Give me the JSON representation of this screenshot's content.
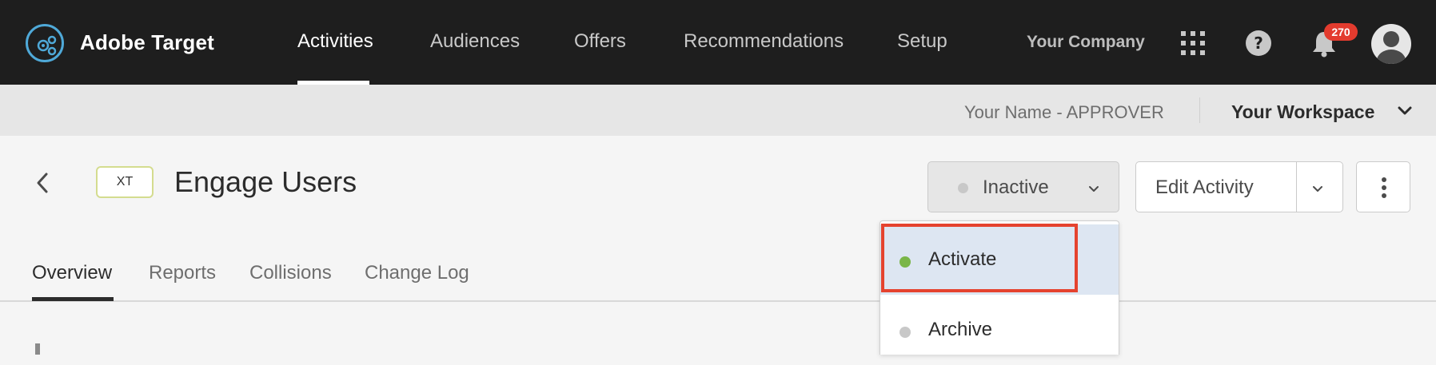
{
  "app": {
    "name": "Adobe Target"
  },
  "nav": {
    "items": [
      {
        "label": "Activities"
      },
      {
        "label": "Audiences"
      },
      {
        "label": "Offers"
      },
      {
        "label": "Recommendations"
      },
      {
        "label": "Setup"
      }
    ],
    "active": "Activities"
  },
  "header": {
    "company": "Your Company",
    "notifications_count": "270",
    "icons": [
      "app-grid-icon",
      "help-icon",
      "bell-icon",
      "user-avatar-icon"
    ]
  },
  "subbar": {
    "user_role": "Your Name - APPROVER",
    "workspace": "Your Workspace"
  },
  "activity": {
    "type_badge": "XT",
    "title": "Engage Users",
    "status": "Inactive",
    "edit_label": "Edit Activity"
  },
  "tabs": [
    {
      "label": "Overview"
    },
    {
      "label": "Reports"
    },
    {
      "label": "Collisions"
    },
    {
      "label": "Change Log"
    }
  ],
  "status_menu": {
    "items": [
      {
        "label": "Activate",
        "dot_color": "#7ab648"
      },
      {
        "label": "Archive",
        "dot_color": "#c8c8c8"
      }
    ]
  },
  "colors": {
    "topbar": "#1e1e1e",
    "accent_logo": "#4fa9d8",
    "badge": "#e33b2e",
    "highlight": "#dde6f2",
    "outline": "#e5432f"
  }
}
